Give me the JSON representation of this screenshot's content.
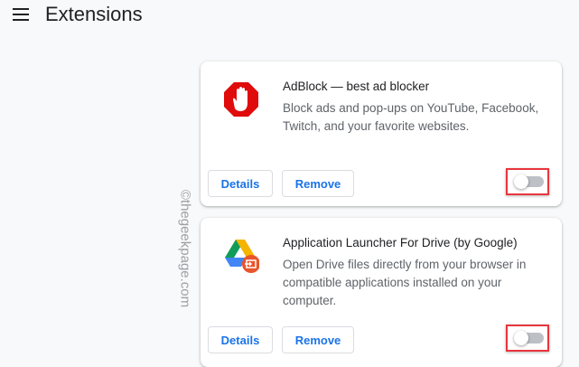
{
  "header": {
    "title": "Extensions",
    "menu_icon": "hamburger-menu-icon"
  },
  "watermark": "©thegeekpage.com",
  "extensions": [
    {
      "name": "AdBlock — best ad blocker",
      "description": "Block ads and pop-ups on YouTube, Facebook, Twitch, and your favorite websites.",
      "details_label": "Details",
      "remove_label": "Remove",
      "enabled": false
    },
    {
      "name": "Application Launcher For Drive (by Google)",
      "description": "Open Drive files directly from your browser in compatible applications installed on your computer.",
      "details_label": "Details",
      "remove_label": "Remove",
      "enabled": false
    }
  ],
  "colors": {
    "accent": "#1a73e8",
    "highlight": "#e8353d",
    "adblock_red": "#e00b0b"
  }
}
